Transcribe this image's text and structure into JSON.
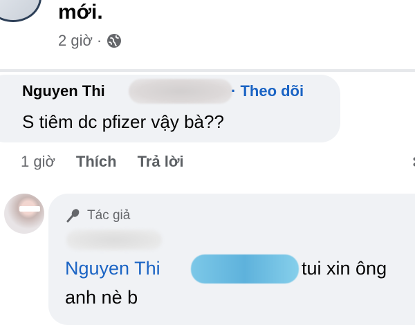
{
  "post": {
    "text_tail": "mới.",
    "time": "2 giờ",
    "separator": "·",
    "privacy_icon": "globe-icon"
  },
  "comment1": {
    "author": "Nguyen Thi",
    "follow_sep": "·",
    "follow_label": "Theo dõi",
    "text": "S tiêm dc pfizer vậy bà??",
    "actions": {
      "time": "1 giờ",
      "like": "Thích",
      "reply": "Trả lời"
    }
  },
  "reply": {
    "badge_icon": "microphone-icon",
    "badge_label": "Tác giả",
    "mention": "Nguyen Thi",
    "text_after": "tui xin ông",
    "text_line2": "anh nè b"
  },
  "colors": {
    "link": "#1b64c4",
    "muted": "#65676b",
    "bubble": "#f0f2f5",
    "redaction_blue": "#5eb2dc"
  }
}
